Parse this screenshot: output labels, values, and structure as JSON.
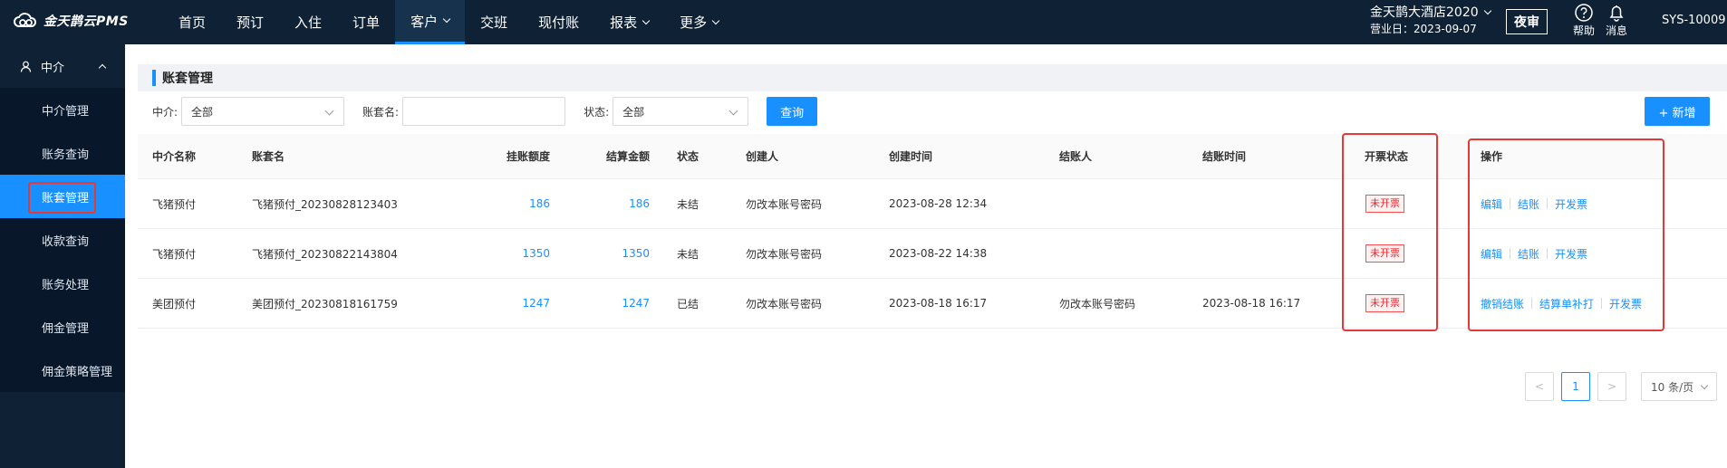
{
  "app": {
    "logo_text": "金天鹊云PMS"
  },
  "nav": [
    {
      "label": "首页"
    },
    {
      "label": "预订"
    },
    {
      "label": "入住"
    },
    {
      "label": "订单"
    },
    {
      "label": "客户"
    },
    {
      "label": "交班"
    },
    {
      "label": "现付账"
    },
    {
      "label": "报表"
    },
    {
      "label": "更多"
    }
  ],
  "header": {
    "hotel_name": "金天鹊大酒店2020",
    "business_date": "营业日：2023-09-07",
    "night_audit": "夜审",
    "help": "帮助",
    "messages": "消息",
    "user": "SYS-10009"
  },
  "sidebar": {
    "group": "中介",
    "items": [
      {
        "label": "中介管理"
      },
      {
        "label": "账务查询"
      },
      {
        "label": "账套管理"
      },
      {
        "label": "收款查询"
      },
      {
        "label": "账务处理"
      },
      {
        "label": "佣金管理"
      },
      {
        "label": "佣金策略管理"
      }
    ]
  },
  "page": {
    "title": "账套管理"
  },
  "filters": {
    "agent_label": "中介:",
    "agent_value": "全部",
    "account_label": "账套名:",
    "account_value": "",
    "status_label": "状态:",
    "status_value": "全部",
    "query_button": "查询",
    "add_button": "+ 新增"
  },
  "table": {
    "columns": [
      "中介名称",
      "账套名",
      "挂账额度",
      "结算金额",
      "状态",
      "创建人",
      "创建时间",
      "结账人",
      "结账时间",
      "开票状态",
      "操作"
    ],
    "rows": [
      {
        "agent": "飞猪预付",
        "account": "飞猪预付_20230828123403",
        "credit": "186",
        "settle": "186",
        "status": "未结",
        "creator": "勿改本账号密码",
        "created": "2023-08-28 12:34",
        "closer": "",
        "closed": "",
        "invoice": "未开票",
        "ops": [
          "编辑",
          "结账",
          "开发票"
        ]
      },
      {
        "agent": "飞猪预付",
        "account": "飞猪预付_20230822143804",
        "credit": "1350",
        "settle": "1350",
        "status": "未结",
        "creator": "勿改本账号密码",
        "created": "2023-08-22 14:38",
        "closer": "",
        "closed": "",
        "invoice": "未开票",
        "ops": [
          "编辑",
          "结账",
          "开发票"
        ]
      },
      {
        "agent": "美团预付",
        "account": "美团预付_20230818161759",
        "credit": "1247",
        "settle": "1247",
        "status": "已结",
        "creator": "勿改本账号密码",
        "created": "2023-08-18 16:17",
        "closer": "勿改本账号密码",
        "closed": "2023-08-18 16:17",
        "invoice": "未开票",
        "ops": [
          "撤销结账",
          "结算单补打",
          "开发票"
        ]
      }
    ]
  },
  "pagination": {
    "current": "1",
    "page_size": "10 条/页",
    "prev": "<",
    "next": ">"
  }
}
